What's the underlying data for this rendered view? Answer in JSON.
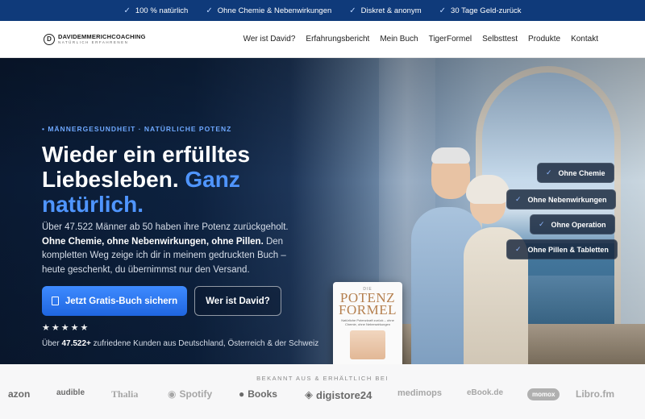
{
  "topbar": {
    "items": [
      "100 % natürlich",
      "Ohne Chemie & Nebenwirkungen",
      "Diskret & anonym",
      "30 Tage Geld-zurück"
    ]
  },
  "nav": {
    "logo_main": "DAVIDEMMERICHCOACHING",
    "logo_sub": "NATÜRLICH ERFAHRENEN",
    "logo_mark": "D",
    "links": [
      "Wer ist David?",
      "Erfahrungsbericht",
      "Mein Buch",
      "TigerFormel",
      "Selbsttest",
      "Produkte",
      "Kontakt"
    ]
  },
  "hero": {
    "eyebrow": "• MÄNNERGESUNDHEIT · NATÜRLICHE POTENZ",
    "headline_white": "Wieder ein erfülltes Liebesleben. ",
    "headline_blue": "Ganz natürlich.",
    "desc_1": "Über 47.522 Männer ab 50 haben ihre Potenz zurückgeholt. ",
    "desc_bold": "Ohne Chemie, ohne Nebenwirkungen, ohne Pillen.",
    "desc_2": " Den kompletten Weg zeige ich dir in meinem gedruckten Buch – heute geschenkt, du übernimmst nur den Versand.",
    "cta_primary": "Jetzt Gratis-Buch sichern",
    "cta_secondary": "Wer ist David?",
    "stars": "★★★★★",
    "rating_stars": 5,
    "proof_pre": "Über ",
    "proof_count": "47.522+",
    "proof_post": " zufriedene Kunden aus Deutschland, Österreich & der Schweiz",
    "badges": [
      "Ohne Chemie",
      "Ohne Nebenwirkungen",
      "Ohne Operation",
      "Ohne Pillen & Tabletten"
    ],
    "book": {
      "small": "DIE",
      "title_1": "POTENZ",
      "title_2": "FORMEL",
      "subtitle": "Natürliche Potenzkraft zurück – ohne Chemie, ohne Nebenwirkungen"
    }
  },
  "logos": {
    "label": "BEKANNT AUS & ERHÄLTLICH BEI",
    "items": [
      "azon",
      "audible",
      "Thalia",
      "Spotify",
      "Books",
      "digistore24",
      "medimops",
      "eBook.de",
      "momox",
      "Libro.fm"
    ]
  },
  "colors": {
    "topbar": "#0f3a7a",
    "accent": "#4f95ff",
    "button": "#2a78f0",
    "hero_dark": "#0a1a33"
  }
}
